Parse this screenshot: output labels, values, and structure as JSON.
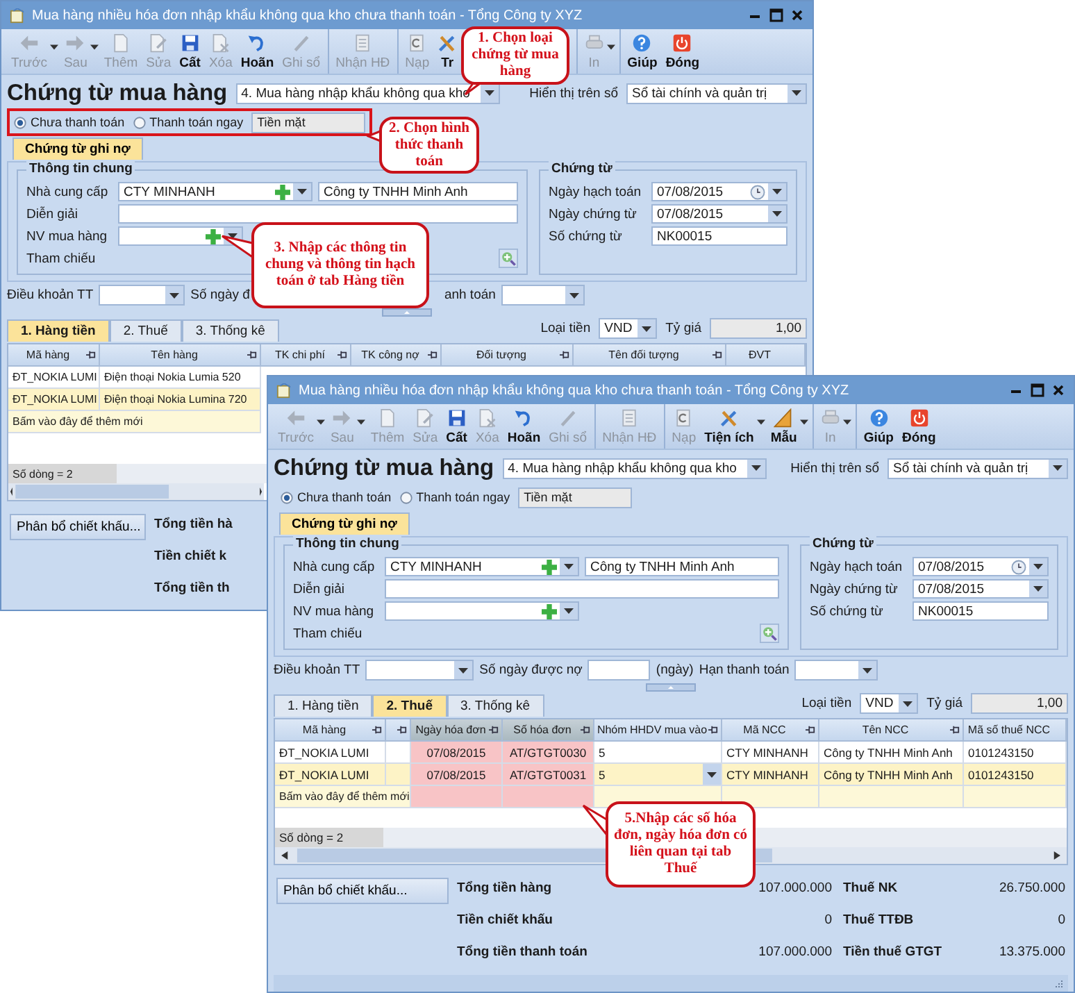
{
  "windows": [
    {
      "title": "Mua hàng nhiều hóa đơn nhập khẩu không qua kho chưa thanh toán - Tổng Công ty XYZ",
      "toolbar": [
        {
          "buttons": [
            {
              "kind": "back",
              "label": "Trước",
              "disabled": true,
              "dropdown": true
            },
            {
              "kind": "forward",
              "label": "Sau",
              "disabled": true,
              "dropdown": true
            },
            {
              "kind": "new",
              "label": "Thêm",
              "disabled": true,
              "dropdown": false
            },
            {
              "kind": "edit",
              "label": "Sửa",
              "disabled": true,
              "dropdown": false
            },
            {
              "kind": "save",
              "label": "Cất",
              "disabled": false,
              "dropdown": false
            },
            {
              "kind": "delete",
              "label": "Xóa",
              "disabled": true,
              "dropdown": false
            },
            {
              "kind": "undo",
              "label": "Hoãn",
              "disabled": false,
              "dropdown": false
            },
            {
              "kind": "post",
              "label": "Ghi sổ",
              "disabled": true,
              "dropdown": false
            }
          ]
        },
        {
          "buttons": [
            {
              "kind": "invoice",
              "label": "Nhận HĐ",
              "disabled": true,
              "dropdown": false
            }
          ]
        },
        {
          "buttons": [
            {
              "kind": "reload",
              "label": "Nạp",
              "disabled": true,
              "dropdown": false
            },
            {
              "kind": "tools",
              "label": "Tr",
              "disabled": false,
              "dropdown": false
            }
          ]
        },
        {
          "buttons": [
            {
              "kind": "print",
              "label": "In",
              "disabled": true,
              "dropdown": true
            }
          ]
        },
        {
          "buttons": [
            {
              "kind": "help",
              "label": "Giúp",
              "disabled": false,
              "dropdown": false
            },
            {
              "kind": "close",
              "label": "Đóng",
              "disabled": false,
              "dropdown": false
            }
          ]
        }
      ],
      "heading": "Chứng từ mua hàng",
      "voucher_type": "4. Mua hàng nhập khẩu không qua kho",
      "ledger_label": "Hiển thị trên sổ",
      "ledger": "Sổ tài chính và quản trị",
      "payment_options": [
        {
          "label": "Chưa thanh toán",
          "selected": true
        },
        {
          "label": "Thanh toán ngay",
          "selected": false
        }
      ],
      "payment_method": "Tiền mặt",
      "main_tab": {
        "label": "Chứng từ ghi nợ",
        "selected": true
      },
      "general": {
        "title": "Thông tin chung",
        "supplier_label": "Nhà cung cấp",
        "supplier_code": "CTY MINHANH",
        "supplier_name": "Công ty TNHH Minh Anh",
        "description_label": "Diễn giải",
        "buyer_label": "NV mua hàng",
        "reference_label": "Tham chiếu"
      },
      "voucher": {
        "title": "Chứng từ",
        "posting_date_label": "Ngày hạch toán",
        "posting_date": "07/08/2015",
        "voucher_date_label": "Ngày chứng từ",
        "voucher_date": "07/08/2015",
        "number_label": "Số chứng từ",
        "number": "NK00015"
      },
      "terms": {
        "terms_label": "Điều khoản TT",
        "days_label": "Số ngày đ",
        "due_label": "anh toán"
      },
      "detail_tabs": [
        {
          "label": "1. Hàng tiền",
          "selected": true
        },
        {
          "label": "2. Thuế",
          "selected": false
        },
        {
          "label": "3. Thống kê",
          "selected": false
        }
      ],
      "currency_label": "Loại tiền",
      "currency": "VND",
      "rate_label": "Tỷ giá",
      "rate": "1,00",
      "grid": {
        "columns": [
          {
            "label": "Mã hàng",
            "pin": true,
            "highlighted": false
          },
          {
            "label": "Tên hàng",
            "pin": true,
            "highlighted": false
          },
          {
            "label": "TK chi phí",
            "pin": true,
            "highlighted": false
          },
          {
            "label": "TK công nợ",
            "pin": true,
            "highlighted": false
          },
          {
            "label": "Đối tượng",
            "pin": true,
            "highlighted": false
          },
          {
            "label": "Tên đối tượng",
            "pin": true,
            "highlighted": false
          },
          {
            "label": "ĐVT",
            "pin": false,
            "highlighted": false
          }
        ],
        "rows": [
          {
            "cells": [
              "ĐT_NOKIA LUMI",
              "Điện thoại Nokia Lumia 520"
            ],
            "selected": false
          },
          {
            "cells": [
              "ĐT_NOKIA LUMI",
              "Điện thoại Nokia Lumina 720"
            ],
            "selected": true
          }
        ],
        "add_row": "Bấm vào đây để thêm mới",
        "row_count": "Số dòng = 2"
      },
      "allocate_button": "Phân bổ chiết khấu...",
      "totals": [
        {
          "label": "Tổng tiền hà"
        },
        {
          "label": "Tiền chiết k"
        },
        {
          "label": "Tổng tiền th"
        }
      ]
    },
    {
      "title": "Mua hàng nhiều hóa đơn nhập khẩu không qua kho chưa thanh toán - Tổng Công ty XYZ",
      "toolbar": [
        {
          "buttons": [
            {
              "kind": "back",
              "label": "Trước",
              "disabled": true,
              "dropdown": true
            },
            {
              "kind": "forward",
              "label": "Sau",
              "disabled": true,
              "dropdown": true
            },
            {
              "kind": "new",
              "label": "Thêm",
              "disabled": true,
              "dropdown": false
            },
            {
              "kind": "edit",
              "label": "Sửa",
              "disabled": true,
              "dropdown": false
            },
            {
              "kind": "save",
              "label": "Cất",
              "disabled": false,
              "dropdown": false
            },
            {
              "kind": "delete",
              "label": "Xóa",
              "disabled": true,
              "dropdown": false
            },
            {
              "kind": "undo",
              "label": "Hoãn",
              "disabled": false,
              "dropdown": false
            },
            {
              "kind": "post",
              "label": "Ghi sổ",
              "disabled": true,
              "dropdown": false
            }
          ]
        },
        {
          "buttons": [
            {
              "kind": "invoice",
              "label": "Nhận HĐ",
              "disabled": true,
              "dropdown": false
            }
          ]
        },
        {
          "buttons": [
            {
              "kind": "reload",
              "label": "Nạp",
              "disabled": true,
              "dropdown": false
            },
            {
              "kind": "tools",
              "label": "Tiện ích",
              "disabled": false,
              "dropdown": true
            },
            {
              "kind": "template",
              "label": "Mẫu",
              "disabled": false,
              "dropdown": true
            }
          ]
        },
        {
          "buttons": [
            {
              "kind": "print",
              "label": "In",
              "disabled": true,
              "dropdown": true
            }
          ]
        },
        {
          "buttons": [
            {
              "kind": "help",
              "label": "Giúp",
              "disabled": false,
              "dropdown": false
            },
            {
              "kind": "close",
              "label": "Đóng",
              "disabled": false,
              "dropdown": false
            }
          ]
        }
      ],
      "heading": "Chứng từ mua hàng",
      "voucher_type": "4. Mua hàng nhập khẩu không qua kho",
      "ledger_label": "Hiển thị trên sổ",
      "ledger": "Sổ tài chính và quản trị",
      "payment_options": [
        {
          "label": "Chưa thanh toán",
          "selected": true
        },
        {
          "label": "Thanh toán ngay",
          "selected": false
        }
      ],
      "payment_method": "Tiền mặt",
      "main_tab": {
        "label": "Chứng từ ghi nợ",
        "selected": true
      },
      "general": {
        "title": "Thông tin chung",
        "supplier_label": "Nhà cung cấp",
        "supplier_code": "CTY MINHANH",
        "supplier_name": "Công ty TNHH Minh Anh",
        "description_label": "Diễn giải",
        "buyer_label": "NV mua hàng",
        "reference_label": "Tham chiếu"
      },
      "voucher": {
        "title": "Chứng từ",
        "posting_date_label": "Ngày hạch toán",
        "posting_date": "07/08/2015",
        "voucher_date_label": "Ngày chứng từ",
        "voucher_date": "07/08/2015",
        "number_label": "Số chứng từ",
        "number": "NK00015"
      },
      "terms": {
        "terms_label": "Điều khoản TT",
        "days_label": "Số ngày được nợ",
        "days_unit": "(ngày)",
        "due_label": "Hạn thanh toán"
      },
      "detail_tabs": [
        {
          "label": "1. Hàng tiền",
          "selected": false
        },
        {
          "label": "2. Thuế",
          "selected": true
        },
        {
          "label": "3. Thống kê",
          "selected": false
        }
      ],
      "currency_label": "Loại tiền",
      "currency": "VND",
      "rate_label": "Tỷ giá",
      "rate": "1,00",
      "grid": {
        "columns": [
          {
            "label": "Mã hàng",
            "kind": "text",
            "pin": true,
            "highlighted": false
          },
          {
            "kind": "text",
            "pin": true,
            "highlighted": false
          },
          {
            "label": "Ngày hóa đơn",
            "kind": "text",
            "pin": true,
            "highlighted": true
          },
          {
            "label": "Số hóa đơn",
            "kind": "text",
            "pin": true,
            "highlighted": true
          },
          {
            "label": "Nhóm HHDV mua vào",
            "kind": "combo",
            "pin": true,
            "highlighted": false
          },
          {
            "label": "Mã NCC",
            "kind": "text",
            "pin": true,
            "highlighted": false
          },
          {
            "label": "Tên NCC",
            "kind": "text",
            "pin": true,
            "highlighted": false
          },
          {
            "label": "Mã số thuế NCC",
            "kind": "text",
            "pin": false,
            "highlighted": false
          }
        ],
        "rows": [
          {
            "cells": [
              "ĐT_NOKIA LUMI",
              "",
              "07/08/2015",
              "AT/GTGT0030",
              "5",
              "CTY MINHANH",
              "Công ty TNHH Minh Anh",
              "0101243150"
            ],
            "selected": false
          },
          {
            "cells": [
              "ĐT_NOKIA LUMI",
              "",
              "07/08/2015",
              "AT/GTGT0031",
              "5",
              "CTY MINHANH",
              "Công ty TNHH Minh Anh",
              "0101243150"
            ],
            "selected": true
          }
        ],
        "add_row": "Bấm vào đây để thêm mới",
        "row_count": "Số dòng = 2"
      },
      "allocate_button": "Phân bổ chiết khấu...",
      "totals": [
        {
          "label": "Tổng tiền hàng",
          "value": "107.000.000",
          "tax_label": "Thuế NK",
          "tax_value": "26.750.000"
        },
        {
          "label": "Tiền chiết khấu",
          "value": "0",
          "tax_label": "Thuế TTĐB",
          "tax_value": "0"
        },
        {
          "label": "Tổng tiền thanh toán",
          "value": "107.000.000",
          "tax_label": "Tiền thuế GTGT",
          "tax_value": "13.375.000"
        }
      ]
    }
  ],
  "callouts": [
    {
      "text": "1. Chọn loại chứng từ mua hàng"
    },
    {
      "text": "2. Chọn hình thức thanh toán"
    },
    {
      "text": "3. Nhập các thông tin chung và thông tin hạch toán ở tab Hàng tiền"
    },
    {
      "text": "5.Nhập các số hóa đơn, ngày hóa đơn có liên quan tại tab Thuế"
    }
  ]
}
